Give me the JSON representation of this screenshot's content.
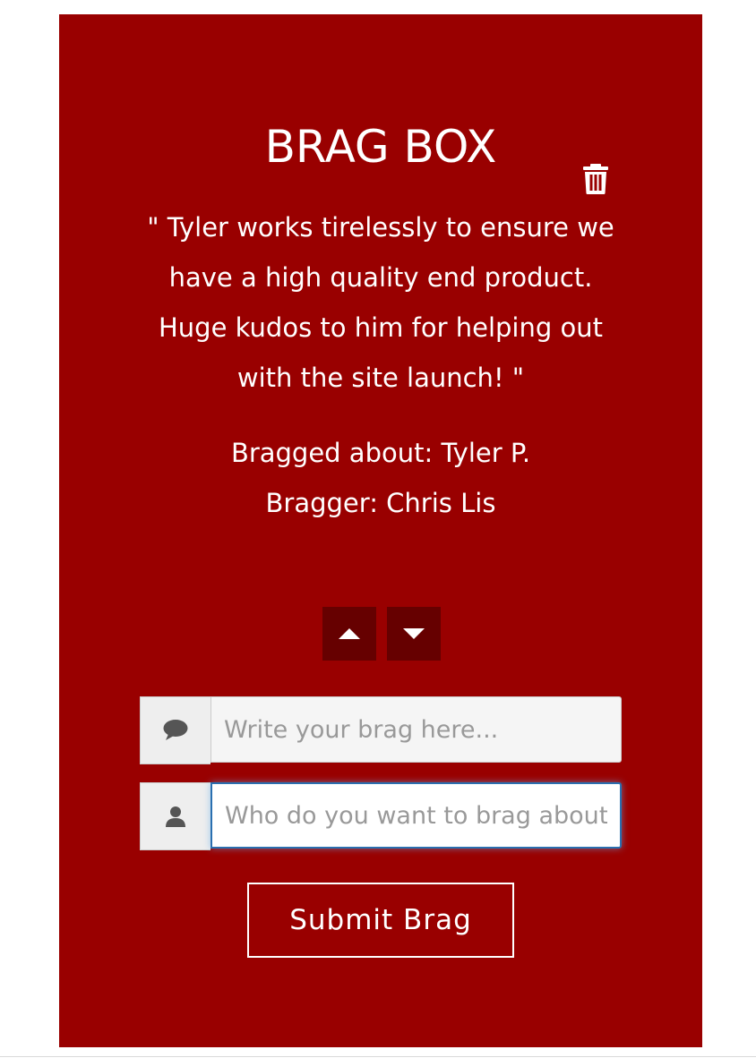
{
  "brag_box": {
    "title": "BRAG BOX",
    "quote": "\" Tyler works tirelessly to ensure we have a high quality end product. Huge kudos to him for helping out with the site launch! \"",
    "bragged_about": "Bragged about: Tyler P.",
    "bragger": "Bragger: Chris Lis",
    "icons": {
      "delete": "trash-icon",
      "upvote": "caret-up-icon",
      "downvote": "caret-down-icon",
      "brag_field": "comment-icon",
      "who_field": "user-icon"
    }
  },
  "form": {
    "brag_placeholder": "Write your brag here...",
    "brag_value": "",
    "who_placeholder": "Who do you want to brag about?",
    "who_value": "",
    "submit_label": "Submit Brag"
  },
  "colors": {
    "card_background": "#990000",
    "vote_button": "#660000",
    "text": "#ffffff",
    "focus_border": "#2a6fb0"
  }
}
